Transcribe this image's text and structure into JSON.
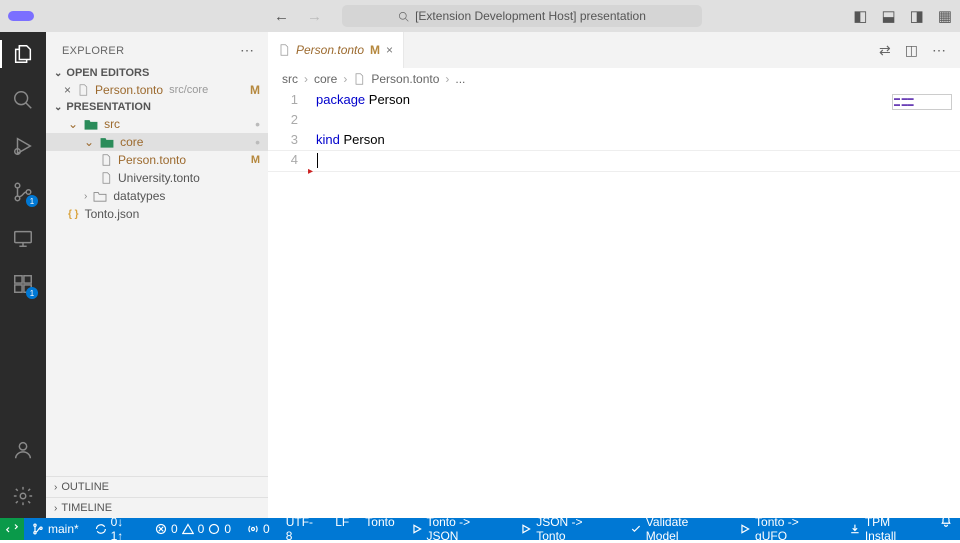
{
  "titlebar": {
    "search": "[Extension Development Host] presentation"
  },
  "sidebar": {
    "header": "EXPLORER",
    "sections": {
      "open_editors": "OPEN EDITORS",
      "project": "PRESENTATION",
      "outline": "OUTLINE",
      "timeline": "TIMELINE"
    },
    "open_editor": {
      "name": "Person.tonto",
      "path": "src/core",
      "status": "M"
    },
    "tree": {
      "src": "src",
      "core": "core",
      "person": "Person.tonto",
      "university": "University.tonto",
      "datatypes": "datatypes",
      "tontojson": "Tonto.json"
    },
    "modified_badge": "M"
  },
  "activity": {
    "scm_badge": "1",
    "ext_badge": "1"
  },
  "editor": {
    "tab": {
      "name": "Person.tonto",
      "status": "M"
    },
    "breadcrumbs": [
      "src",
      "core",
      "Person.tonto",
      "..."
    ],
    "lines": {
      "l1_kw": "package",
      "l1_id": "Person",
      "l3_kw": "kind",
      "l3_id": "Person"
    },
    "line_numbers": [
      "1",
      "2",
      "3",
      "4"
    ]
  },
  "statusbar": {
    "branch": "main*",
    "sync": "0↓ 1↑",
    "problems": "0  0  0",
    "ports": "0",
    "encoding": "UTF-8",
    "eol": "LF",
    "lang": "Tonto",
    "cmd1": "Tonto -> JSON",
    "cmd2": "JSON -> Tonto",
    "cmd3": "Validate Model",
    "cmd4": "Tonto -> gUFO",
    "cmd5": "TPM Install"
  }
}
